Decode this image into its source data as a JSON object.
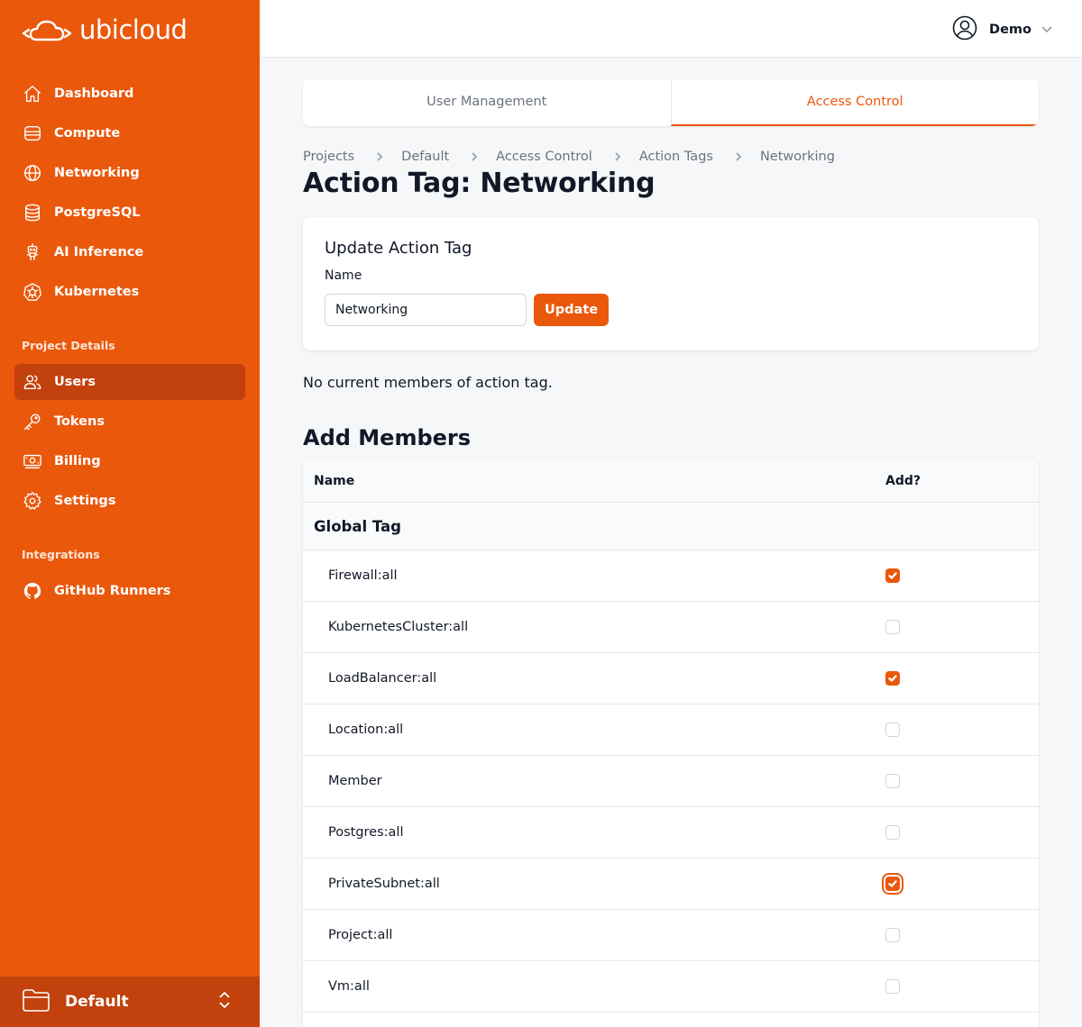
{
  "brand": {
    "name": "ubicloud",
    "accent": "#ea580c",
    "accent_dark": "#c2410c"
  },
  "sidebar": {
    "main_items": [
      {
        "label": "Dashboard",
        "icon": "home-icon"
      },
      {
        "label": "Compute",
        "icon": "server-icon"
      },
      {
        "label": "Networking",
        "icon": "globe-icon"
      },
      {
        "label": "PostgreSQL",
        "icon": "database-icon"
      },
      {
        "label": "AI Inference",
        "icon": "robot-icon"
      },
      {
        "label": "Kubernetes",
        "icon": "kubernetes-icon"
      }
    ],
    "project_section_label": "Project Details",
    "project_items": [
      {
        "label": "Users",
        "icon": "users-icon",
        "active": true
      },
      {
        "label": "Tokens",
        "icon": "key-icon"
      },
      {
        "label": "Billing",
        "icon": "banknote-icon"
      },
      {
        "label": "Settings",
        "icon": "gear-icon"
      }
    ],
    "integrations_section_label": "Integrations",
    "integration_items": [
      {
        "label": "GitHub Runners",
        "icon": "github-icon"
      }
    ],
    "project_switcher": {
      "name": "Default"
    }
  },
  "topbar": {
    "user_name": "Demo"
  },
  "tabs": [
    {
      "label": "User Management",
      "active": false
    },
    {
      "label": "Access Control",
      "active": true
    }
  ],
  "breadcrumb": [
    "Projects",
    "Default",
    "Access Control",
    "Action Tags",
    "Networking"
  ],
  "page_title": "Action Tag: Networking",
  "update_form": {
    "title": "Update Action Tag",
    "name_label": "Name",
    "name_value": "Networking",
    "submit_label": "Update"
  },
  "members_status": "No current members of action tag.",
  "add_members": {
    "title": "Add Members",
    "columns": {
      "name": "Name",
      "add": "Add?"
    },
    "group": "Global Tag",
    "rows": [
      {
        "name": "Firewall:all",
        "checked": true
      },
      {
        "name": "KubernetesCluster:all",
        "checked": false
      },
      {
        "name": "LoadBalancer:all",
        "checked": true
      },
      {
        "name": "Location:all",
        "checked": false
      },
      {
        "name": "Member",
        "checked": false
      },
      {
        "name": "Postgres:all",
        "checked": false
      },
      {
        "name": "PrivateSubnet:all",
        "checked": true,
        "focused": true
      },
      {
        "name": "Project:all",
        "checked": false
      },
      {
        "name": "Vm:all",
        "checked": false
      }
    ]
  }
}
